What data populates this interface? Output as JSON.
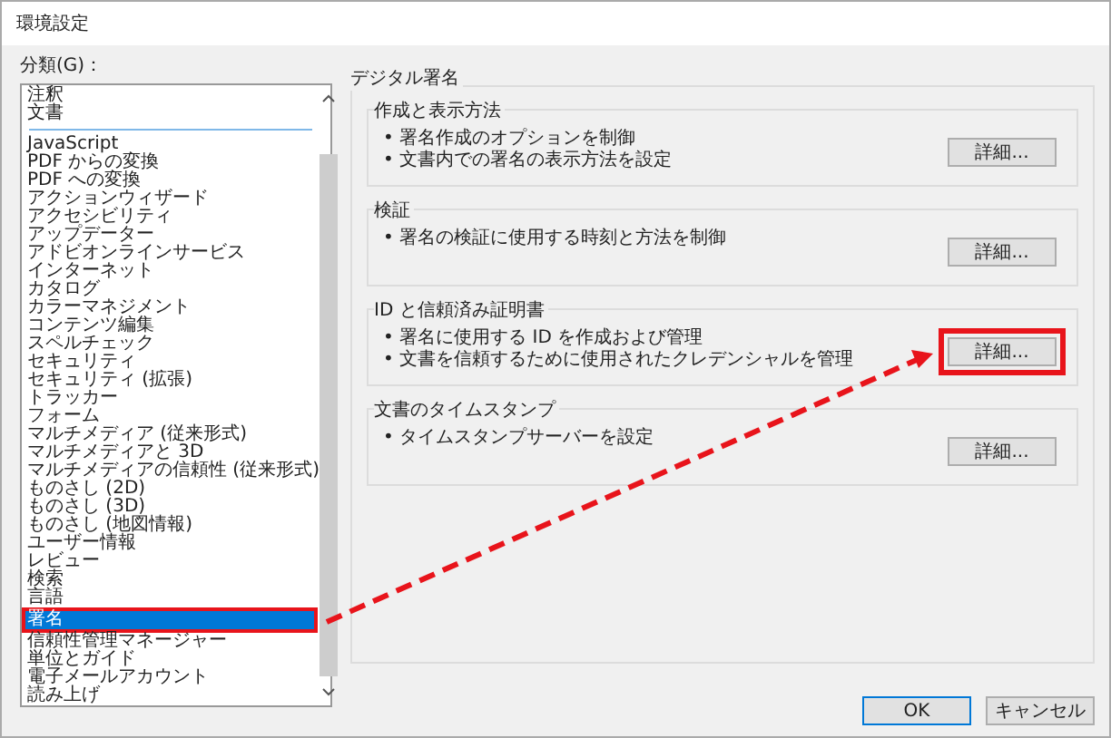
{
  "window": {
    "title": "環境設定"
  },
  "categories": {
    "label": "分類(G)：",
    "items": [
      {
        "label": "注釈",
        "selected": false,
        "highlighted": false,
        "separator_after": false
      },
      {
        "label": "文書",
        "selected": false,
        "highlighted": false,
        "separator_after": true
      },
      {
        "label": "JavaScript",
        "selected": false,
        "highlighted": false,
        "separator_after": false
      },
      {
        "label": "PDF からの変換",
        "selected": false,
        "highlighted": false,
        "separator_after": false
      },
      {
        "label": "PDF への変換",
        "selected": false,
        "highlighted": false,
        "separator_after": false
      },
      {
        "label": "アクションウィザード",
        "selected": false,
        "highlighted": false,
        "separator_after": false
      },
      {
        "label": "アクセシビリティ",
        "selected": false,
        "highlighted": false,
        "separator_after": false
      },
      {
        "label": "アップデーター",
        "selected": false,
        "highlighted": false,
        "separator_after": false
      },
      {
        "label": "アドビオンラインサービス",
        "selected": false,
        "highlighted": false,
        "separator_after": false
      },
      {
        "label": "インターネット",
        "selected": false,
        "highlighted": false,
        "separator_after": false
      },
      {
        "label": "カタログ",
        "selected": false,
        "highlighted": false,
        "separator_after": false
      },
      {
        "label": "カラーマネジメント",
        "selected": false,
        "highlighted": false,
        "separator_after": false
      },
      {
        "label": "コンテンツ編集",
        "selected": false,
        "highlighted": false,
        "separator_after": false
      },
      {
        "label": "スペルチェック",
        "selected": false,
        "highlighted": false,
        "separator_after": false
      },
      {
        "label": "セキュリティ",
        "selected": false,
        "highlighted": false,
        "separator_after": false
      },
      {
        "label": "セキュリティ (拡張)",
        "selected": false,
        "highlighted": false,
        "separator_after": false
      },
      {
        "label": "トラッカー",
        "selected": false,
        "highlighted": false,
        "separator_after": false
      },
      {
        "label": "フォーム",
        "selected": false,
        "highlighted": false,
        "separator_after": false
      },
      {
        "label": "マルチメディア (従来形式)",
        "selected": false,
        "highlighted": false,
        "separator_after": false
      },
      {
        "label": "マルチメディアと 3D",
        "selected": false,
        "highlighted": false,
        "separator_after": false
      },
      {
        "label": "マルチメディアの信頼性 (従来形式)",
        "selected": false,
        "highlighted": false,
        "separator_after": false
      },
      {
        "label": "ものさし (2D)",
        "selected": false,
        "highlighted": false,
        "separator_after": false
      },
      {
        "label": "ものさし (3D)",
        "selected": false,
        "highlighted": false,
        "separator_after": false
      },
      {
        "label": "ものさし (地図情報)",
        "selected": false,
        "highlighted": false,
        "separator_after": false
      },
      {
        "label": "ユーザー情報",
        "selected": false,
        "highlighted": false,
        "separator_after": false
      },
      {
        "label": "レビュー",
        "selected": false,
        "highlighted": false,
        "separator_after": false
      },
      {
        "label": "検索",
        "selected": false,
        "highlighted": false,
        "separator_after": false
      },
      {
        "label": "言語",
        "selected": false,
        "highlighted": false,
        "separator_after": false
      },
      {
        "label": "署名",
        "selected": true,
        "highlighted": true,
        "separator_after": false
      },
      {
        "label": "信頼性管理マネージャー",
        "selected": false,
        "highlighted": false,
        "separator_after": false
      },
      {
        "label": "単位とガイド",
        "selected": false,
        "highlighted": false,
        "separator_after": false
      },
      {
        "label": "電子メールアカウント",
        "selected": false,
        "highlighted": false,
        "separator_after": false
      },
      {
        "label": "読み上げ",
        "selected": false,
        "highlighted": false,
        "separator_after": false
      }
    ]
  },
  "panel": {
    "title": "デジタル署名",
    "sections": [
      {
        "title": "作成と表示方法",
        "bullets": [
          "• 署名作成のオプションを制御",
          "• 文書内での署名の表示方法を設定"
        ],
        "button": "詳細...",
        "highlighted": false
      },
      {
        "title": "検証",
        "bullets": [
          "• 署名の検証に使用する時刻と方法を制御"
        ],
        "button": "詳細...",
        "highlighted": false
      },
      {
        "title": "ID と信頼済み証明書",
        "bullets": [
          "• 署名に使用する ID を作成および管理",
          "• 文書を信頼するために使用されたクレデンシャルを管理"
        ],
        "button": "詳細...",
        "highlighted": true
      },
      {
        "title": "文書のタイムスタンプ",
        "bullets": [
          "• タイムスタンプサーバーを設定"
        ],
        "button": "詳細...",
        "highlighted": false
      }
    ]
  },
  "footer_buttons": [
    {
      "label": "OK",
      "default": true
    },
    {
      "label": "キャンセル",
      "default": false
    }
  ]
}
